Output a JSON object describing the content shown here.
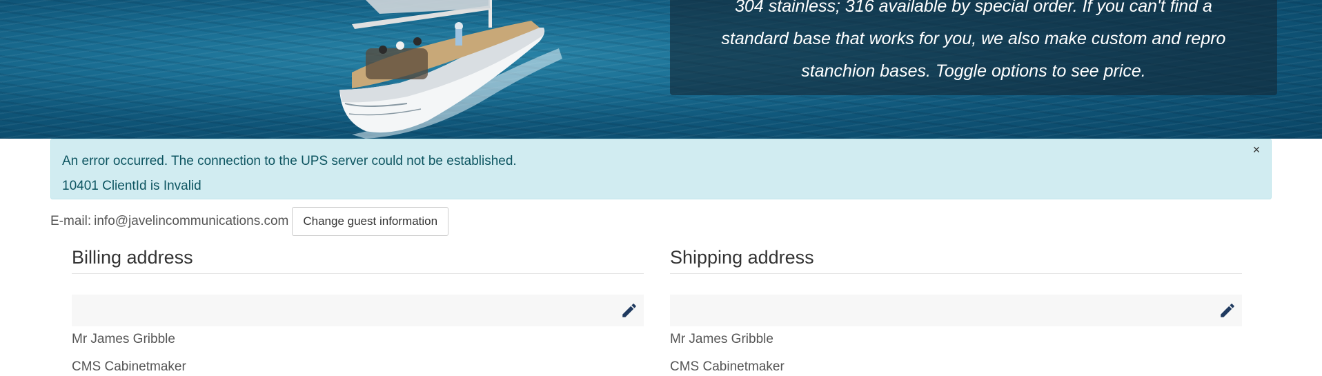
{
  "hero": {
    "info_lines": [
      "304 stainless; 316 available by special order. If you can't find a",
      "standard base that works for you, we also make custom and repro",
      "stanchion bases. Toggle options to see price."
    ]
  },
  "alert": {
    "line1": "An error occurred. The connection to the UPS server could not be established.",
    "line2": "10401 ClientId is Invalid",
    "close_label": "×"
  },
  "guest": {
    "email_label": "E-mail:",
    "email": "info@javelincommunications.com",
    "change_button": "Change guest information"
  },
  "billing": {
    "title": "Billing address",
    "name": "Mr James Gribble",
    "line2": "CMS Cabinetmaker"
  },
  "shipping": {
    "title": "Shipping address",
    "name": "Mr James Gribble",
    "line2": "CMS Cabinetmaker"
  },
  "colors": {
    "alert_bg": "#d1ecf1",
    "alert_text": "#0c5460",
    "edit_icon": "#1f3a5f"
  },
  "icons": {
    "edit": "pencil-icon",
    "close": "close-icon"
  }
}
